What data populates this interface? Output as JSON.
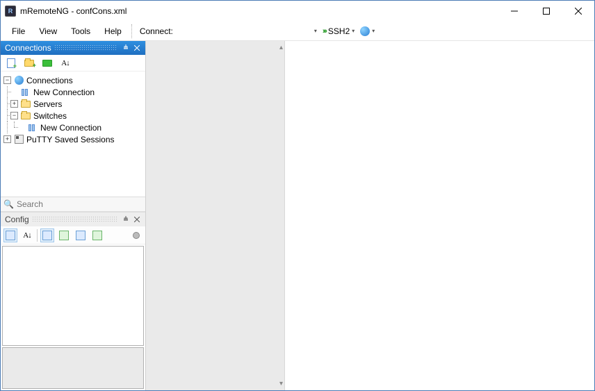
{
  "window": {
    "title": "mRemoteNG - confCons.xml"
  },
  "menu": {
    "file": "File",
    "view": "View",
    "tools": "Tools",
    "help": "Help",
    "connect_label": "Connect:",
    "protocol": "SSH2"
  },
  "connections_panel": {
    "title": "Connections",
    "search_placeholder": "Search"
  },
  "tree": {
    "root": "Connections",
    "new_connection_1": "New Connection",
    "servers": "Servers",
    "switches": "Switches",
    "new_connection_2": "New Connection",
    "putty": "PuTTY Saved Sessions"
  },
  "config_panel": {
    "title": "Config"
  }
}
